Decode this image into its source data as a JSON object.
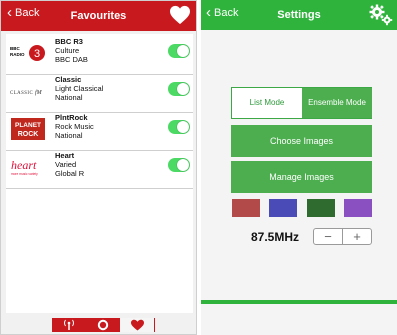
{
  "favourites_screen": {
    "back_label": "Back",
    "title": "Favourites",
    "stations": [
      {
        "name": "BBC R3",
        "genre": "Culture",
        "network": "BBC DAB",
        "logo": "bbc-radio-3-logo",
        "logo_text": "BBC RADIO 3",
        "enabled": true
      },
      {
        "name": "Classic",
        "genre": "Light Classical",
        "network": "National",
        "logo": "classic-fm-logo",
        "logo_text": "CLASSIC fM",
        "enabled": true
      },
      {
        "name": "PlntRock",
        "genre": "Rock Music",
        "network": "National",
        "logo": "planet-rock-logo",
        "logo_text": "PLANET ROCK",
        "enabled": true
      },
      {
        "name": "Heart",
        "genre": "Varied",
        "network": "Global R",
        "logo": "heart-logo",
        "logo_text": "heart",
        "enabled": true
      }
    ],
    "tabs": [
      "radio-tower-icon",
      "circle-icon",
      "heart-icon"
    ],
    "selected_tab": 2,
    "colors": {
      "header": "#c8191e",
      "toggle_on": "#4cd964"
    }
  },
  "settings_screen": {
    "back_label": "Back",
    "title": "Settings",
    "mode_options": [
      "List Mode",
      "Ensemble Mode"
    ],
    "selected_mode": "List Mode",
    "choose_images_label": "Choose Images",
    "manage_images_label": "Manage Images",
    "color_swatches": [
      "#b34a4a",
      "#4b4bb8",
      "#2f6a2f",
      "#8a4fc0"
    ],
    "frequency": "87.5MHz",
    "stepper": {
      "minus": "−",
      "plus": "+"
    },
    "colors": {
      "header": "#2fb33d",
      "button": "#4cae4f"
    }
  }
}
